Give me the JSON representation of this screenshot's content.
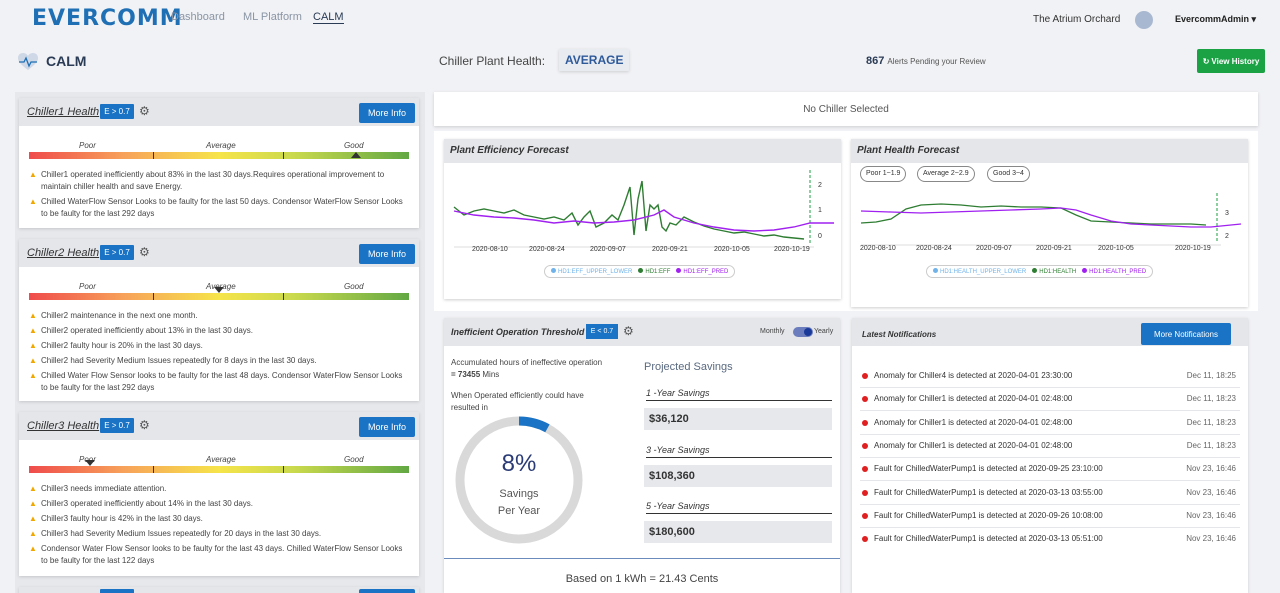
{
  "brand": {
    "name": "EVERCOMM"
  },
  "nav": {
    "dashboard": "Dashboard",
    "ml_platform": "ML Platform",
    "calm": "CALM"
  },
  "site": "The Atrium Orchard",
  "user": "EvercommAdmin",
  "page": {
    "title": "CALM"
  },
  "plant_health": {
    "label": "Chiller Plant Health:",
    "value": "AVERAGE"
  },
  "alerts": {
    "count": "867",
    "text": "Alerts Pending your Review"
  },
  "view_history": "View History",
  "no_chiller": "No Chiller Selected",
  "scale": {
    "poor": "Poor",
    "average": "Average",
    "good": "Good"
  },
  "chillers": [
    {
      "title": "Chiller1 Health",
      "badge": "E > 0.7",
      "more": "More Info",
      "level": 0.86,
      "messages": [
        "Chiller1 operated inefficiently about 83% in the last 30 days.Requires operational improvement to maintain chiller health and save Energy.",
        "Chilled WaterFlow Sensor Looks to be faulty for the last 50 days. Condensor WaterFlow Sensor Looks to be faulty for the last 292 days"
      ]
    },
    {
      "title": "Chiller2 Health",
      "badge": "E > 0.7",
      "more": "More Info",
      "level": 0.5,
      "messages": [
        "Chiller2 maintenance in the next one month.",
        "Chiller2 operated inefficiently about 13% in the last 30 days.",
        "Chiller2 faulty hour is 20% in the last 30 days.",
        "Chiller2 had Severity Medium Issues repeatedly for 8 days in the last 30 days.",
        "Chilled Water Flow Sensor looks to be faulty for the last 48 days. Condensor WaterFlow Sensor Looks to be faulty for the last 292 days"
      ]
    },
    {
      "title": "Chiller3 Health",
      "badge": "E > 0.7",
      "more": "More Info",
      "level": 0.16,
      "messages": [
        "Chiller3 needs immediate attention.",
        "Chiller3 operated inefficiently about 14% in the last 30 days.",
        "Chiller3 faulty hour is 42% in the last 30 days.",
        "Chiller3 had Severity Medium Issues repeatedly for 20 days in the last 30 days.",
        "Condensor Water Flow Sensor looks to be faulty for the last 43 days. Chilled WaterFlow Sensor Looks to be faulty for the last 122 days"
      ]
    }
  ],
  "efficiency_forecast": {
    "title": "Plant Efficiency Forecast",
    "x_ticks": [
      "2020-08-10",
      "2020-08-24",
      "2020-09-07",
      "2020-09-21",
      "2020-10-05",
      "2020-10-19"
    ],
    "y_ticks": [
      "2",
      "1",
      "0"
    ],
    "legend": [
      "HD1:EFF_UPPER_LOWER",
      "HD1:EFF",
      "HD1:EFF_PRED"
    ]
  },
  "health_forecast": {
    "title": "Plant Health Forecast",
    "pills": [
      "Poor 1~1.9",
      "Average 2~2.9",
      "Good 3~4"
    ],
    "x_ticks": [
      "2020-08-10",
      "2020-08-24",
      "2020-09-07",
      "2020-09-21",
      "2020-10-05",
      "2020-10-19"
    ],
    "y_ticks": [
      "3",
      "2"
    ],
    "legend": [
      "HD1:HEALTH_UPPER_LOWER",
      "HD1:HEALTH",
      "HD1:HEALTH_PRED"
    ]
  },
  "threshold": {
    "title": "Inefficient Operation Threshold",
    "badge": "E < 0.7",
    "monthly": "Monthly",
    "yearly": "Yearly",
    "acc_label": "Accumulated hours of ineffective operation",
    "acc_value": "= 73455",
    "acc_unit": "Mins",
    "when_text": "When Operated efficiently could have resulted in",
    "percent": "8%",
    "savings_label1": "Savings",
    "savings_label2": "Per Year",
    "percent_fraction": 0.08,
    "projected": "Projected Savings",
    "years": [
      {
        "label": "1 -Year Savings",
        "value": "$36,120"
      },
      {
        "label": "3 -Year Savings",
        "value": "$108,360"
      },
      {
        "label": "5 -Year Savings",
        "value": "$180,600"
      }
    ],
    "based_on": "Based on 1 kWh = 21.43 Cents"
  },
  "notifications": {
    "title": "Latest Notifications",
    "button": "More Notifications",
    "items": [
      {
        "text": "Anomaly for Chiller4 is detected at 2020-04-01 23:30:00",
        "time": "Dec 11, 18:25"
      },
      {
        "text": "Anomaly for Chiller1 is detected at 2020-04-01 02:48:00",
        "time": "Dec 11, 18:23"
      },
      {
        "text": "Anomaly for Chiller1 is detected at 2020-04-01 02:48:00",
        "time": "Dec 11, 18:23"
      },
      {
        "text": "Anomaly for Chiller1 is detected at 2020-04-01 02:48:00",
        "time": "Dec 11, 18:23"
      },
      {
        "text": "Fault for ChilledWaterPump1 is detected at 2020-09-25 23:10:00",
        "time": "Nov 23, 16:46"
      },
      {
        "text": "Fault for ChilledWaterPump1 is detected at 2020-03-13 03:55:00",
        "time": "Nov 23, 16:46"
      },
      {
        "text": "Fault for ChilledWaterPump1 is detected at 2020-09-26 10:08:00",
        "time": "Nov 23, 16:46"
      },
      {
        "text": "Fault for ChilledWaterPump1 is detected at 2020-03-13 05:51:00",
        "time": "Nov 23, 16:46"
      }
    ]
  },
  "colors": {
    "accent": "#1a73c4",
    "green": "#1aa245",
    "purple": "#a020f0",
    "darkgreen": "#2e7d32"
  }
}
